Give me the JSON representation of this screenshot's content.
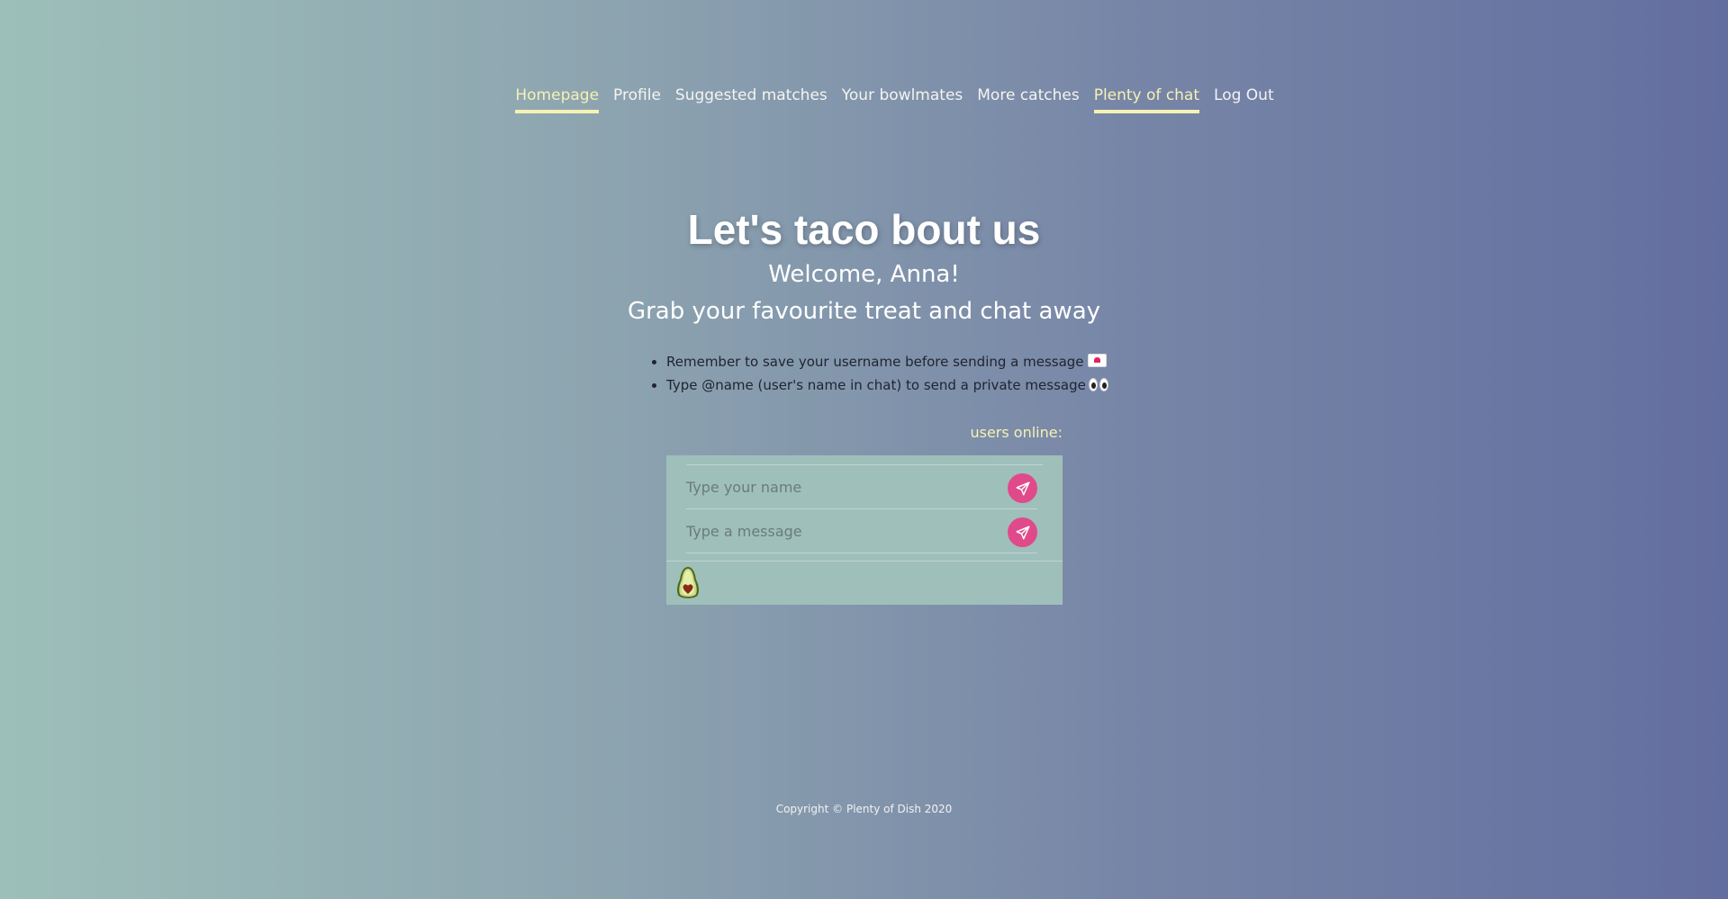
{
  "nav": {
    "items": [
      {
        "label": "Homepage",
        "active": true
      },
      {
        "label": "Profile",
        "active": false
      },
      {
        "label": "Suggested matches",
        "active": false
      },
      {
        "label": "Your bowlmates",
        "active": false
      },
      {
        "label": "More catches",
        "active": false
      },
      {
        "label": "Plenty of chat",
        "active": true
      },
      {
        "label": "Log Out",
        "active": false
      }
    ]
  },
  "header": {
    "title": "Let's taco bout us",
    "welcome": "Welcome, Anna!",
    "tagline": "Grab your favourite treat and chat away"
  },
  "tips": [
    {
      "text": "Remember to save your username before sending a message",
      "emoji": "love-letter-icon"
    },
    {
      "text": "Type @name (user's name in chat) to send a private message",
      "emoji": "eyes-icon"
    }
  ],
  "chat": {
    "users_online_label": "users online:",
    "name_placeholder": "Type your name",
    "message_placeholder": "Type a message",
    "send_icon": "send-icon",
    "typing_icon": "avocado-icon"
  },
  "colors": {
    "accent_yellow": "#f6f1b4",
    "send_button": "#e04a8a",
    "panel": "#9fbfba"
  },
  "footer": {
    "copyright": "Copyright © Plenty of Dish 2020"
  }
}
